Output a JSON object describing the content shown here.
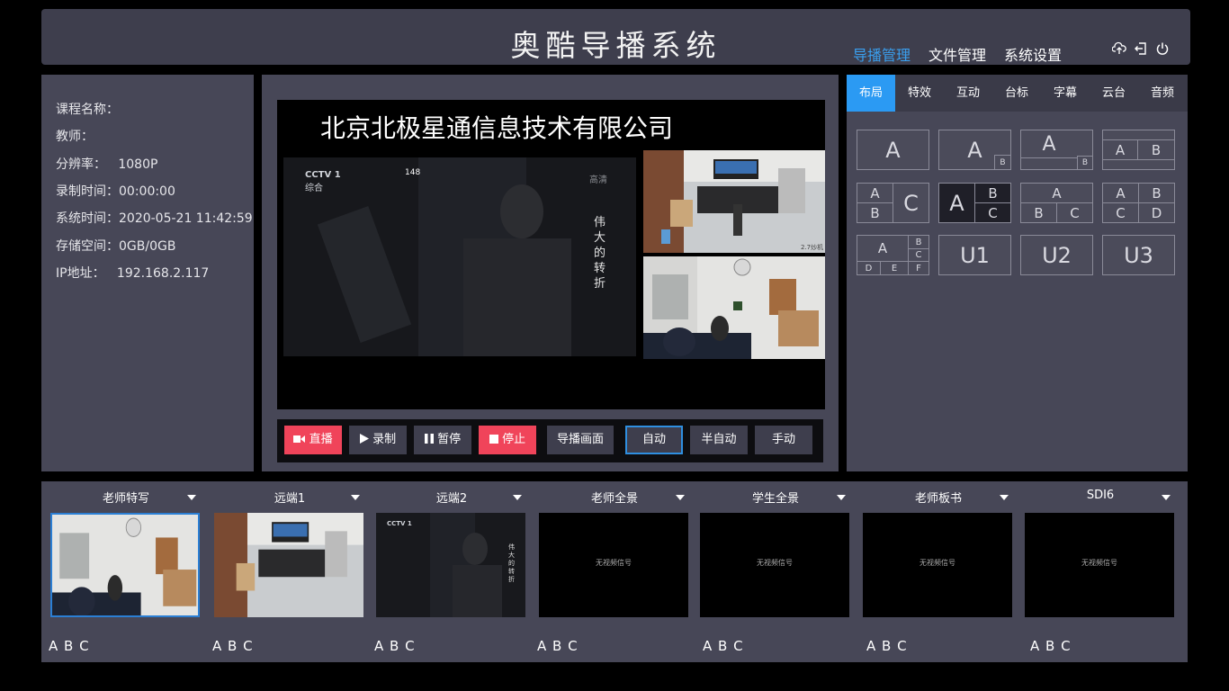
{
  "header": {
    "title": "奥酷导播系统",
    "nav": [
      "导播管理",
      "文件管理",
      "系统设置"
    ],
    "nav_active": 0,
    "icons": [
      "upload-icon",
      "logout-icon",
      "power-icon"
    ]
  },
  "info": {
    "course": "课程名称：",
    "teacher": "教师：",
    "resolution": "分辨率：   1080P",
    "rec_time": "录制时间：00:00:00",
    "sys_time": "系统时间：2020-05-21 11:42:59",
    "storage": "存储空间：0GB/0GB",
    "ip": "IP地址：   192.168.2.117"
  },
  "preview": {
    "overlay_title": "北京北极星通信息技术有限公司",
    "channel_logo": "CCTV 1",
    "channel_sub": "综合",
    "badge_num": "148",
    "badge_hd": "高清",
    "vertical_text": "伟大的转折",
    "cam_label": "2.7炒机"
  },
  "controls": {
    "live": "直播",
    "record": "录制",
    "pause": "暂停",
    "stop": "停止",
    "director": "导播画面",
    "auto": "自动",
    "semi": "半自动",
    "manual": "手动"
  },
  "tabs": [
    "布局",
    "特效",
    "互动",
    "台标",
    "字幕",
    "云台",
    "音频"
  ],
  "layouts": {
    "A": "A",
    "B": "B",
    "C": "C",
    "D": "D",
    "E": "E",
    "F": "F",
    "U1": "U1",
    "U2": "U2",
    "U3": "U3"
  },
  "sources": [
    {
      "name": "老师特写",
      "labels": "A B C",
      "signal": ""
    },
    {
      "name": "远端1",
      "labels": "A B C",
      "signal": ""
    },
    {
      "name": "远端2",
      "labels": "A B C",
      "signal": ""
    },
    {
      "name": "老师全景",
      "labels": "A B C",
      "signal": "无视频信号"
    },
    {
      "name": "学生全景",
      "labels": "A B C",
      "signal": "无视频信号"
    },
    {
      "name": "老师板书",
      "labels": "A B C",
      "signal": "无视频信号"
    },
    {
      "name": "SDI6",
      "labels": "A B C",
      "signal": "无视频信号"
    }
  ],
  "colors": {
    "accent": "#2b9af3",
    "danger": "#f0445a",
    "panel": "#474757"
  }
}
